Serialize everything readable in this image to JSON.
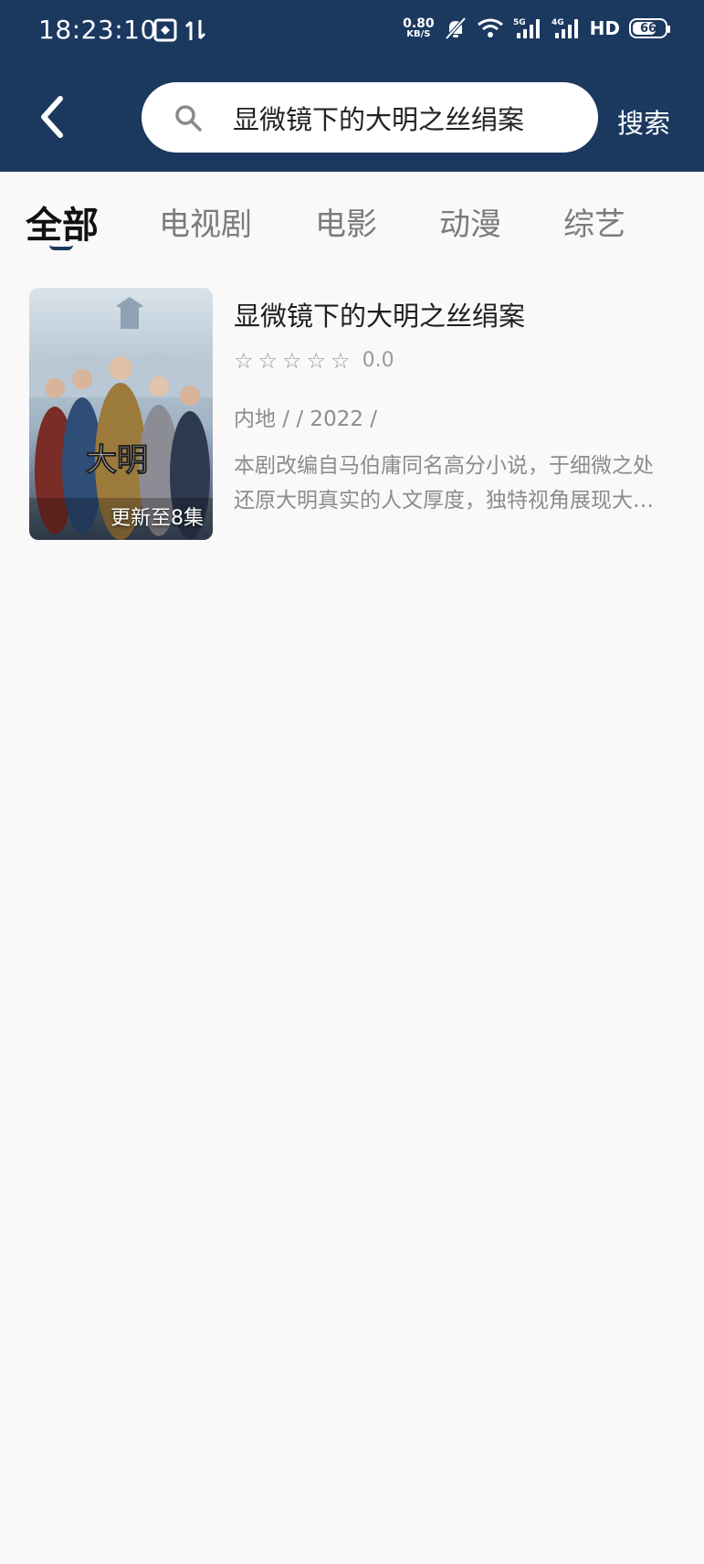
{
  "status": {
    "time": "18:23:10",
    "net_speed_value": "0.80",
    "net_speed_unit": "KB/S",
    "signal_5g": "5G",
    "signal_4g": "4G",
    "hd": "HD",
    "battery": "66",
    "battery_level": 0.66
  },
  "search": {
    "query": "显微镜下的大明之丝绢案",
    "button_label": "搜索"
  },
  "tabs": [
    {
      "label": "全部",
      "active": true
    },
    {
      "label": "电视剧",
      "active": false
    },
    {
      "label": "电影",
      "active": false
    },
    {
      "label": "动漫",
      "active": false
    },
    {
      "label": "综艺",
      "active": false
    }
  ],
  "results": [
    {
      "title": "显微镜下的大明之丝绢案",
      "rating": "0.0",
      "meta": "内地 /  / 2022 /",
      "description": "本剧改编自马伯庸同名高分小说，于细微之处还原大明真实的人文厚度，独特视角展现大明政治图景",
      "badge": "更新至8集",
      "poster_title": "大明"
    }
  ]
}
